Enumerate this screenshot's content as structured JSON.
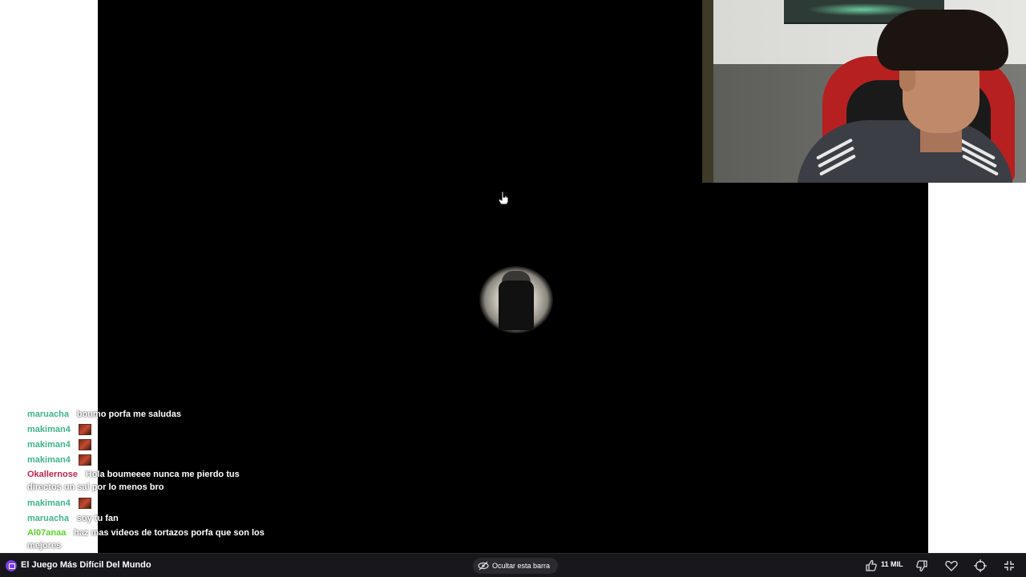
{
  "chat": {
    "messages": [
      {
        "user": "maruacha",
        "user_color": "#3fb28f",
        "text": "boumo porfa me saludas",
        "emote": false
      },
      {
        "user": "makiman4",
        "user_color": "#3fb28f",
        "text": "",
        "emote": true
      },
      {
        "user": "makiman4",
        "user_color": "#3fb28f",
        "text": "",
        "emote": true
      },
      {
        "user": "makiman4",
        "user_color": "#3fb28f",
        "text": "",
        "emote": true
      },
      {
        "user": "Okallernose",
        "user_color": "#c0264f",
        "text": "Hola boumeeee nunca me pierdo tus directos un sal por lo menos bro",
        "emote": false
      },
      {
        "user": "makiman4",
        "user_color": "#3fb28f",
        "text": "",
        "emote": true
      },
      {
        "user": "maruacha",
        "user_color": "#3fb28f",
        "text": "soy tu fan",
        "emote": false
      },
      {
        "user": "Al07anaa",
        "user_color": "#5ad12a",
        "text": "haz mas videos de tortazos porfa que son los mejores",
        "emote": false
      }
    ]
  },
  "bottom_bar": {
    "stream_title": "El Juego Más Difícil Del Mundo",
    "hide_bar_label": "Ocultar esta barra",
    "likes": "11 MIL"
  },
  "icons": {
    "logo": "stream-platform-logo-icon",
    "hide": "eye-slash-icon",
    "like": "thumbs-up-icon",
    "dislike": "thumbs-down-icon",
    "favorite": "heart-icon",
    "crosshair": "crosshair-icon",
    "exit_fullscreen": "minimize-icon",
    "cursor": "hand-pointer-icon"
  },
  "colors": {
    "bar_bg": "#17171c",
    "logo_purple": "#7b3fe4"
  }
}
